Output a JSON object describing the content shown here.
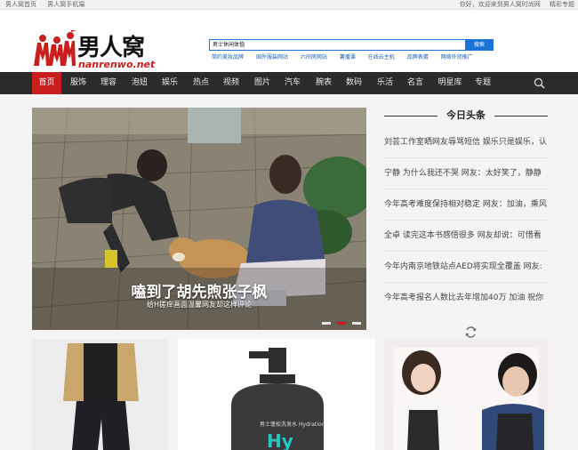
{
  "topbar": {
    "left_links": [
      "男人窝首页",
      "男人窝手机端"
    ],
    "right_links": [
      "你好，欢迎来到男人窝时尚网",
      "精彩专题"
    ]
  },
  "logo": {
    "cn_text": "男人窝",
    "en_text": "nanrenwo.net"
  },
  "search": {
    "value": "男士休闲体恤",
    "button_label": "搜索",
    "hot_words": [
      "简约美妆品牌",
      "国外服装网站",
      "六间房网站",
      "薯播课",
      "在线云主机",
      "品牌表蛋",
      "网络外贸推广"
    ]
  },
  "nav": {
    "items": [
      "首页",
      "服饰",
      "理容",
      "泡妞",
      "娱乐",
      "热点",
      "视频",
      "图片",
      "汽车",
      "腕表",
      "数码",
      "乐活",
      "名言",
      "明星库",
      "专题"
    ],
    "active_index": 0
  },
  "hero": {
    "title": "嗑到了胡先煦张子枫",
    "subtitle": "给H搓痒画面温馨网友却这样评论",
    "slide_count": 6,
    "active_slide": 1
  },
  "headlines": {
    "title": "今日头条",
    "items": [
      "刘芸工作室晒网友辱骂短信 娱乐只是娱乐，认",
      "宁静 为什么我还不哭 网友：太好笑了，静静",
      "今年高考难度保持相对稳定 网友：加油，乘风",
      "全卓 读完这本书感悟很多 网友却说：可惜看",
      "今年内南京地铁站点AED将实现全覆盖 网友:",
      "今年高考报名人数比去年增加40万 加油 祝你"
    ]
  },
  "colors": {
    "brand_red": "#c81e1e",
    "nav_bg": "#2b2b2b",
    "search_blue": "#1a73d9"
  },
  "product": {
    "brand_text": "Hy"
  }
}
